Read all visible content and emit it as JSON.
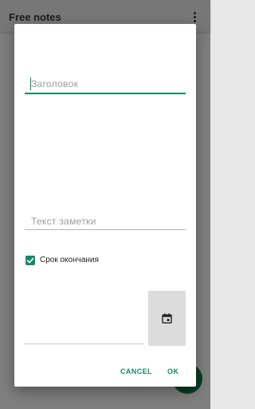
{
  "appbar": {
    "title": "Free notes"
  },
  "dialog": {
    "title_placeholder": "Заголовок",
    "note_placeholder": "Текст заметки",
    "due_date_checkbox": {
      "label": "Срок окончания",
      "checked": true
    },
    "date_value": "",
    "buttons": {
      "cancel": "CANCEL",
      "ok": "OK"
    }
  },
  "colors": {
    "accent": "#138a67",
    "fab": "#0e6e4a",
    "scrim": "rgba(0,0,0,0.45)"
  },
  "icons": {
    "overflow": "more-vert-icon",
    "calendar": "calendar-icon",
    "checkmark": "check-icon"
  }
}
